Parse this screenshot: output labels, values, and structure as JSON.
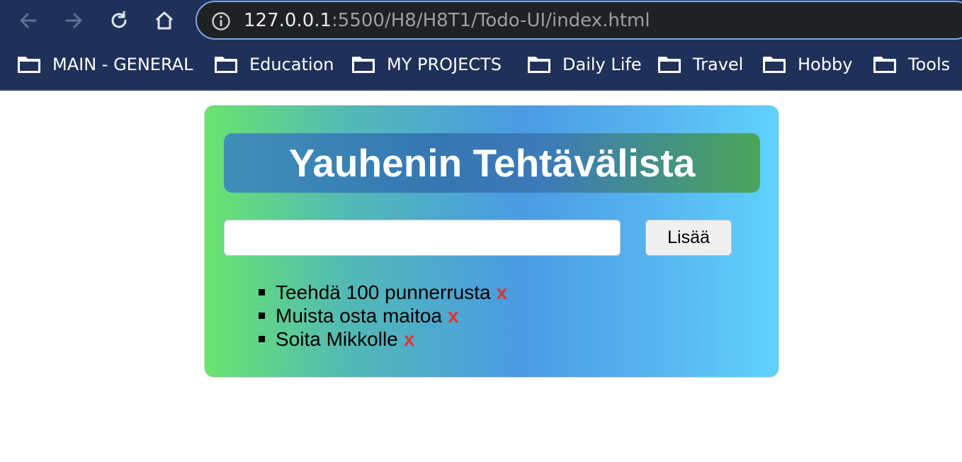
{
  "browser": {
    "url_host": "127.0.0.1",
    "url_rest": ":5500/H8/H8T1/Todo-UI/index.html",
    "icons": [
      "back-arrow-icon",
      "forward-arrow-icon",
      "reload-icon",
      "home-icon",
      "info-icon",
      "folder-icon"
    ]
  },
  "bookmarks": [
    {
      "label": "MAIN - GENERAL"
    },
    {
      "label": "Education"
    },
    {
      "label": "MY PROJECTS"
    },
    {
      "label": "Daily Life"
    },
    {
      "label": "Travel"
    },
    {
      "label": "Hobby"
    },
    {
      "label": "Tools"
    }
  ],
  "todo": {
    "title": "Yauhenin Tehtävälista",
    "input_value": "",
    "add_label": "Lisää",
    "delete_label": "x",
    "items": [
      {
        "text": "Teehdä 100 punnerrusta"
      },
      {
        "text": "Muista osta maitoa"
      },
      {
        "text": "Soita Mikkolle"
      }
    ]
  },
  "colors": {
    "chrome": "#1f3158",
    "address_bar": "#202124",
    "delete": "#e5322d"
  }
}
